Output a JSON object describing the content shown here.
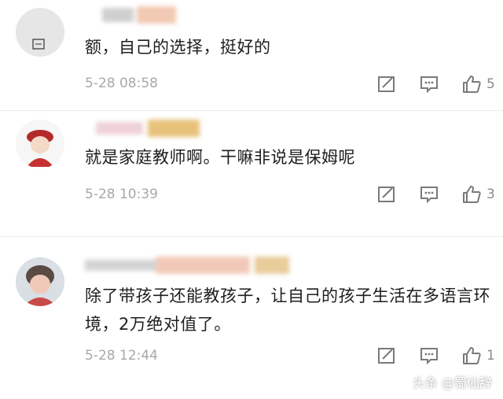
{
  "comments": [
    {
      "text": "额，自己的选择，挺好的",
      "time": "5-28 08:58",
      "likes": "5"
    },
    {
      "text": "就是家庭教师啊。干嘛非说是保姆呢",
      "time": "5-28 10:39",
      "likes": "3"
    },
    {
      "text": "除了带孩子还能教孩子，让自己的孩子生活在多语言环境，2万绝对值了。",
      "time": "5-28 12:44",
      "likes": "1"
    }
  ],
  "icons": [
    "share-icon",
    "comment-icon",
    "like-icon"
  ],
  "watermark": {
    "text": "头条 @蜀仙辞"
  }
}
